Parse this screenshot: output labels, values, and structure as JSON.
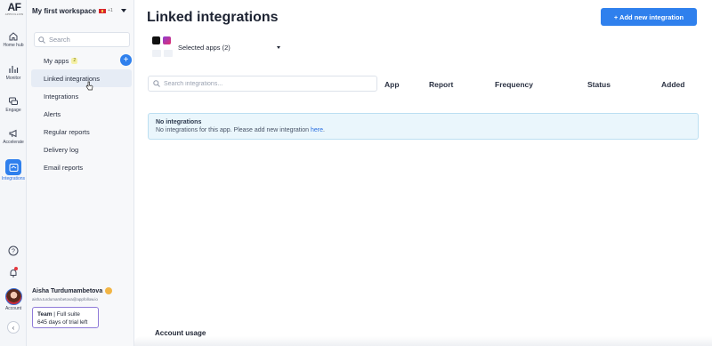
{
  "logo": {
    "mark": "AF",
    "sub": "APPFOLLOW"
  },
  "rail": {
    "home": "Home hub",
    "monitor": "Monitor",
    "engage": "Engage",
    "accelerate": "Accelerate",
    "integrations": "Integrations",
    "account": "Account"
  },
  "workspace": {
    "name": "My first workspace",
    "extra": "+1"
  },
  "sidebar": {
    "search_placeholder": "Search",
    "items": [
      {
        "label": "My apps",
        "badge": "2"
      },
      {
        "label": "Linked integrations"
      },
      {
        "label": "Integrations"
      },
      {
        "label": "Alerts"
      },
      {
        "label": "Regular reports"
      },
      {
        "label": "Delivery log"
      },
      {
        "label": "Email reports"
      }
    ]
  },
  "user": {
    "name": "Aisha Turdumambetova",
    "email": "aisha.turdumambetova@appfollow.io",
    "plan_team": "Team",
    "plan_rest": " | Full suite",
    "trial": "645 days of trial left"
  },
  "main": {
    "title": "Linked integrations",
    "add_button": "+ Add new integration",
    "selected_apps": "Selected apps (2)",
    "search_placeholder": "Search integrations...",
    "columns": [
      "App",
      "Report",
      "Frequency",
      "Status",
      "Added"
    ],
    "notice_title": "No integrations",
    "notice_text": "No integrations for this app. Please add new integration ",
    "notice_link": "here",
    "notice_end": ".",
    "usage_title": "Account usage"
  },
  "colors": {
    "accent": "#2f80ed",
    "notice_bg": "#eaf6fc",
    "notice_border": "#bcdff2"
  }
}
